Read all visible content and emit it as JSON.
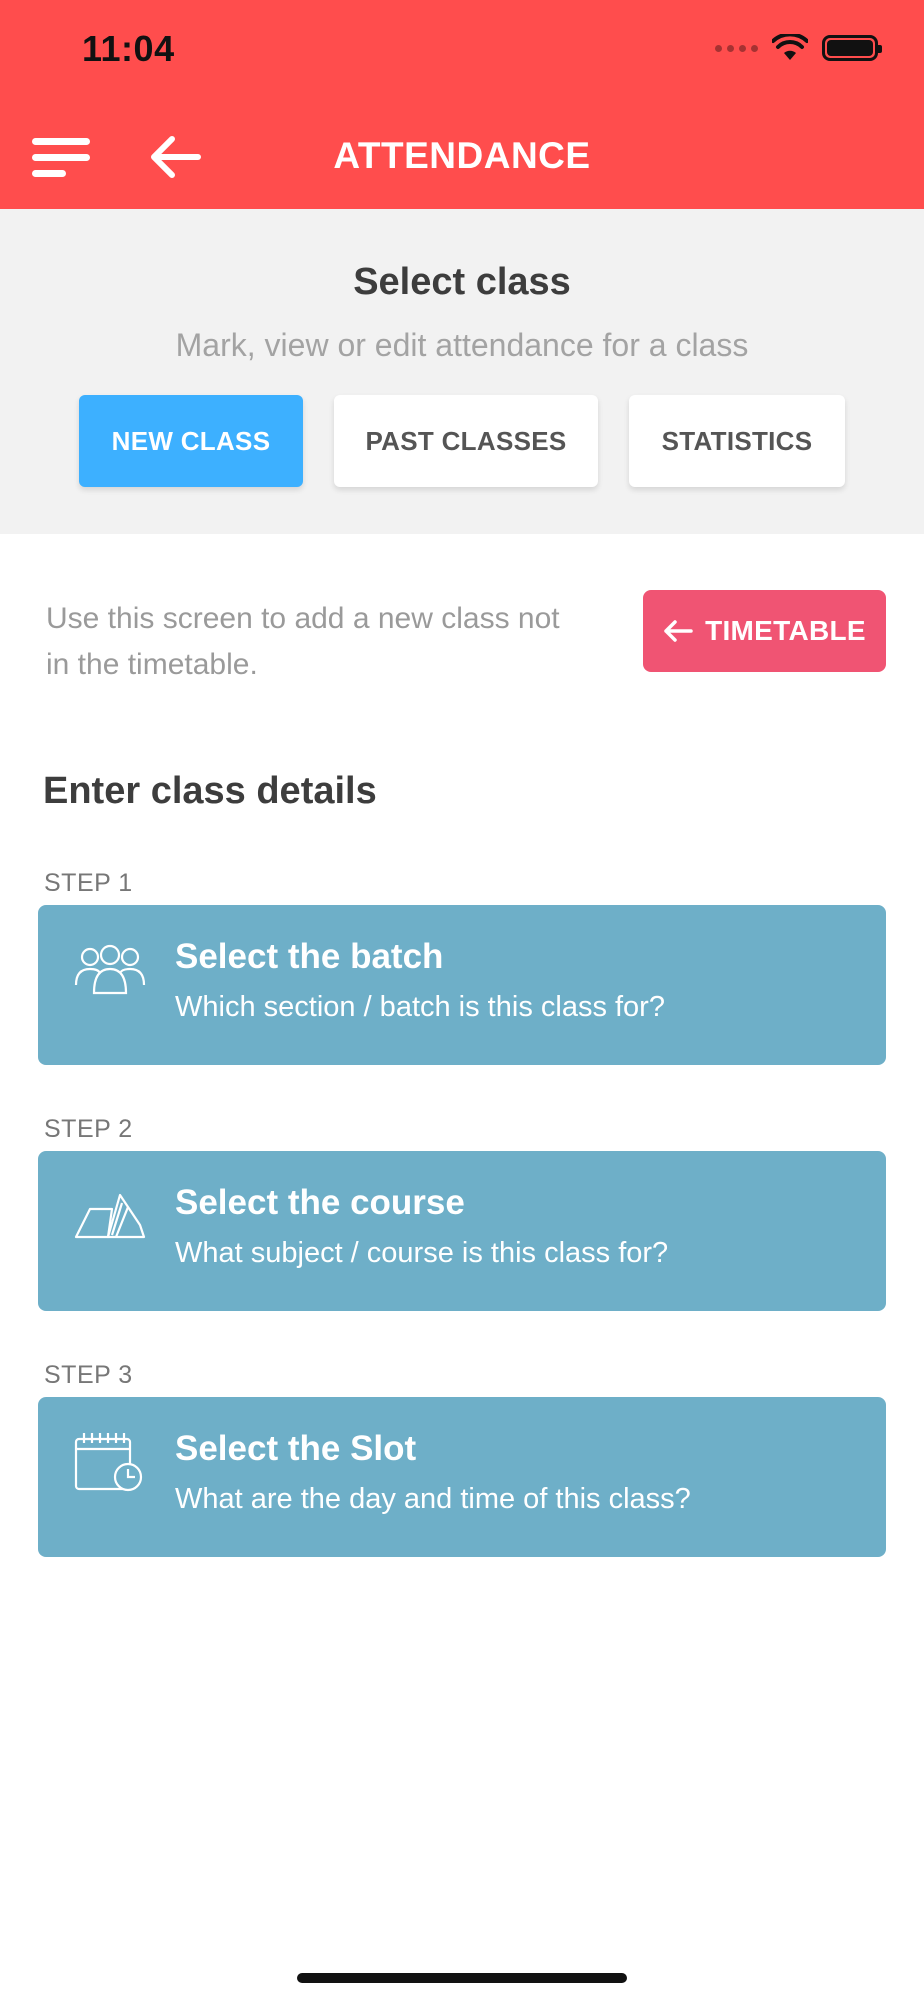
{
  "status_bar": {
    "time": "11:04"
  },
  "header": {
    "title": "ATTENDANCE"
  },
  "icons": {
    "menu": "hamburger-menu-icon",
    "back": "arrow-left-icon",
    "wifi": "wifi-icon",
    "battery": "battery-icon",
    "batch": "group-people-icon",
    "course": "open-book-icon",
    "slot": "calendar-clock-icon"
  },
  "select_class": {
    "title": "Select class",
    "subtitle": "Mark, view or edit attendance for a class",
    "tabs": [
      {
        "label": "NEW CLASS",
        "active": true
      },
      {
        "label": "PAST CLASSES",
        "active": false
      },
      {
        "label": "STATISTICS",
        "active": false
      }
    ]
  },
  "info": {
    "text": "Use this screen to add a new class not in the timetable.",
    "timetable_button": "TIMETABLE"
  },
  "details": {
    "title": "Enter class details",
    "steps": [
      {
        "step": "STEP 1",
        "title": "Select the batch",
        "subtitle": "Which section / batch is this class for?"
      },
      {
        "step": "STEP 2",
        "title": "Select the course",
        "subtitle": "What subject / course is this class for?"
      },
      {
        "step": "STEP 3",
        "title": "Select the Slot",
        "subtitle": "What are the day and time of this class?"
      }
    ]
  },
  "colors": {
    "header": "#ff4d4d",
    "active_tab": "#3db0ff",
    "timetable_button": "#f05473",
    "card": "#6eafc8"
  }
}
